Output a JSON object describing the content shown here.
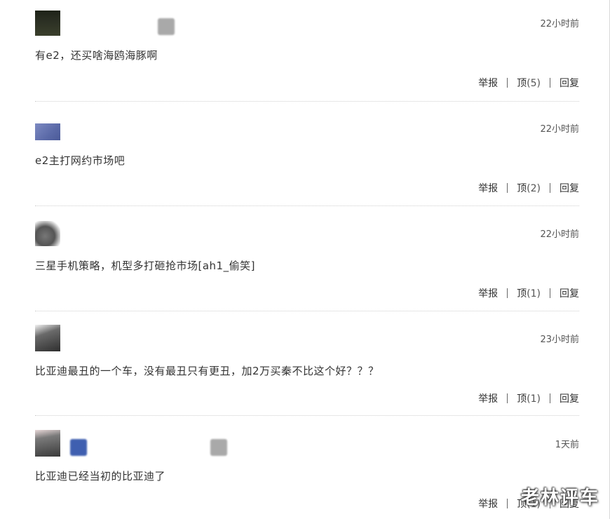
{
  "comments": [
    {
      "time": "22小时前",
      "text": "有e2，还买啥海鸥海豚啊",
      "report": "举报",
      "top": "顶",
      "count": "(5)",
      "reply": "回复"
    },
    {
      "time": "22小时前",
      "text": "e2主打网约市场吧",
      "report": "举报",
      "top": "顶",
      "count": "(2)",
      "reply": "回复"
    },
    {
      "time": "22小时前",
      "text": "三星手机策略，机型多打砸抢市场[ah1_偷笑]",
      "report": "举报",
      "top": "顶",
      "count": "(1)",
      "reply": "回复"
    },
    {
      "time": "23小时前",
      "text": "比亚迪最丑的一个车，没有最丑只有更丑，加2万买秦不比这个好？？？",
      "report": "举报",
      "top": "顶",
      "count": "(1)",
      "reply": "回复"
    },
    {
      "time": "1天前",
      "text": "比亚迪已经当初的比亚迪了",
      "report": "举报",
      "top": "顶",
      "count": "(1)",
      "reply": "回复"
    }
  ],
  "colors": {
    "avatar_1": "#2b2f23",
    "avatar_2": "#5b6aa8",
    "avatar_3": "#555555",
    "avatar_4": "#3a3a3a",
    "avatar_5": "#4a4a4a",
    "badge_gray": "#a9a9a9",
    "badge_blue": "#3f5fb0"
  },
  "watermark": "老林评车"
}
